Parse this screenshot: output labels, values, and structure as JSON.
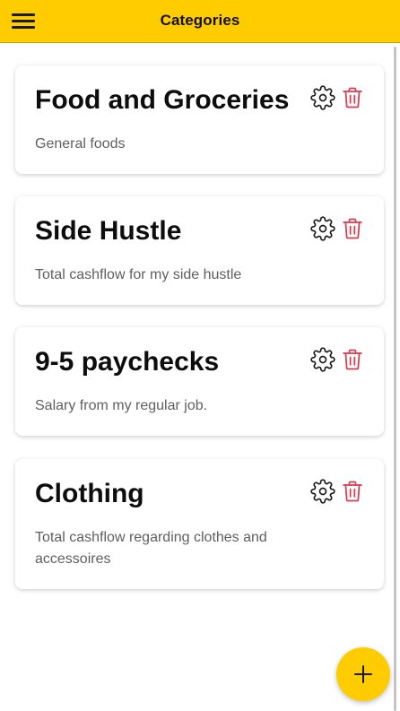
{
  "header": {
    "title": "Categories",
    "menu_icon": "hamburger-menu-icon",
    "background_color": "#FFCC00"
  },
  "categories": [
    {
      "title": "Food and Groceries",
      "description": "General foods",
      "settings_icon": "gear-icon",
      "delete_icon": "trash-icon"
    },
    {
      "title": "Side Hustle",
      "description": "Total cashflow for my side hustle",
      "settings_icon": "gear-icon",
      "delete_icon": "trash-icon"
    },
    {
      "title": "9-5 paychecks",
      "description": "Salary from my regular job.",
      "settings_icon": "gear-icon",
      "delete_icon": "trash-icon"
    },
    {
      "title": "Clothing",
      "description": "Total cashflow regarding clothes and accessoires",
      "settings_icon": "gear-icon",
      "delete_icon": "trash-icon"
    }
  ],
  "fab": {
    "icon": "plus-icon",
    "color": "#FFCC00"
  },
  "colors": {
    "accent": "#FFCC00",
    "delete": "#D93B50",
    "description_text": "#5f5f5f"
  }
}
